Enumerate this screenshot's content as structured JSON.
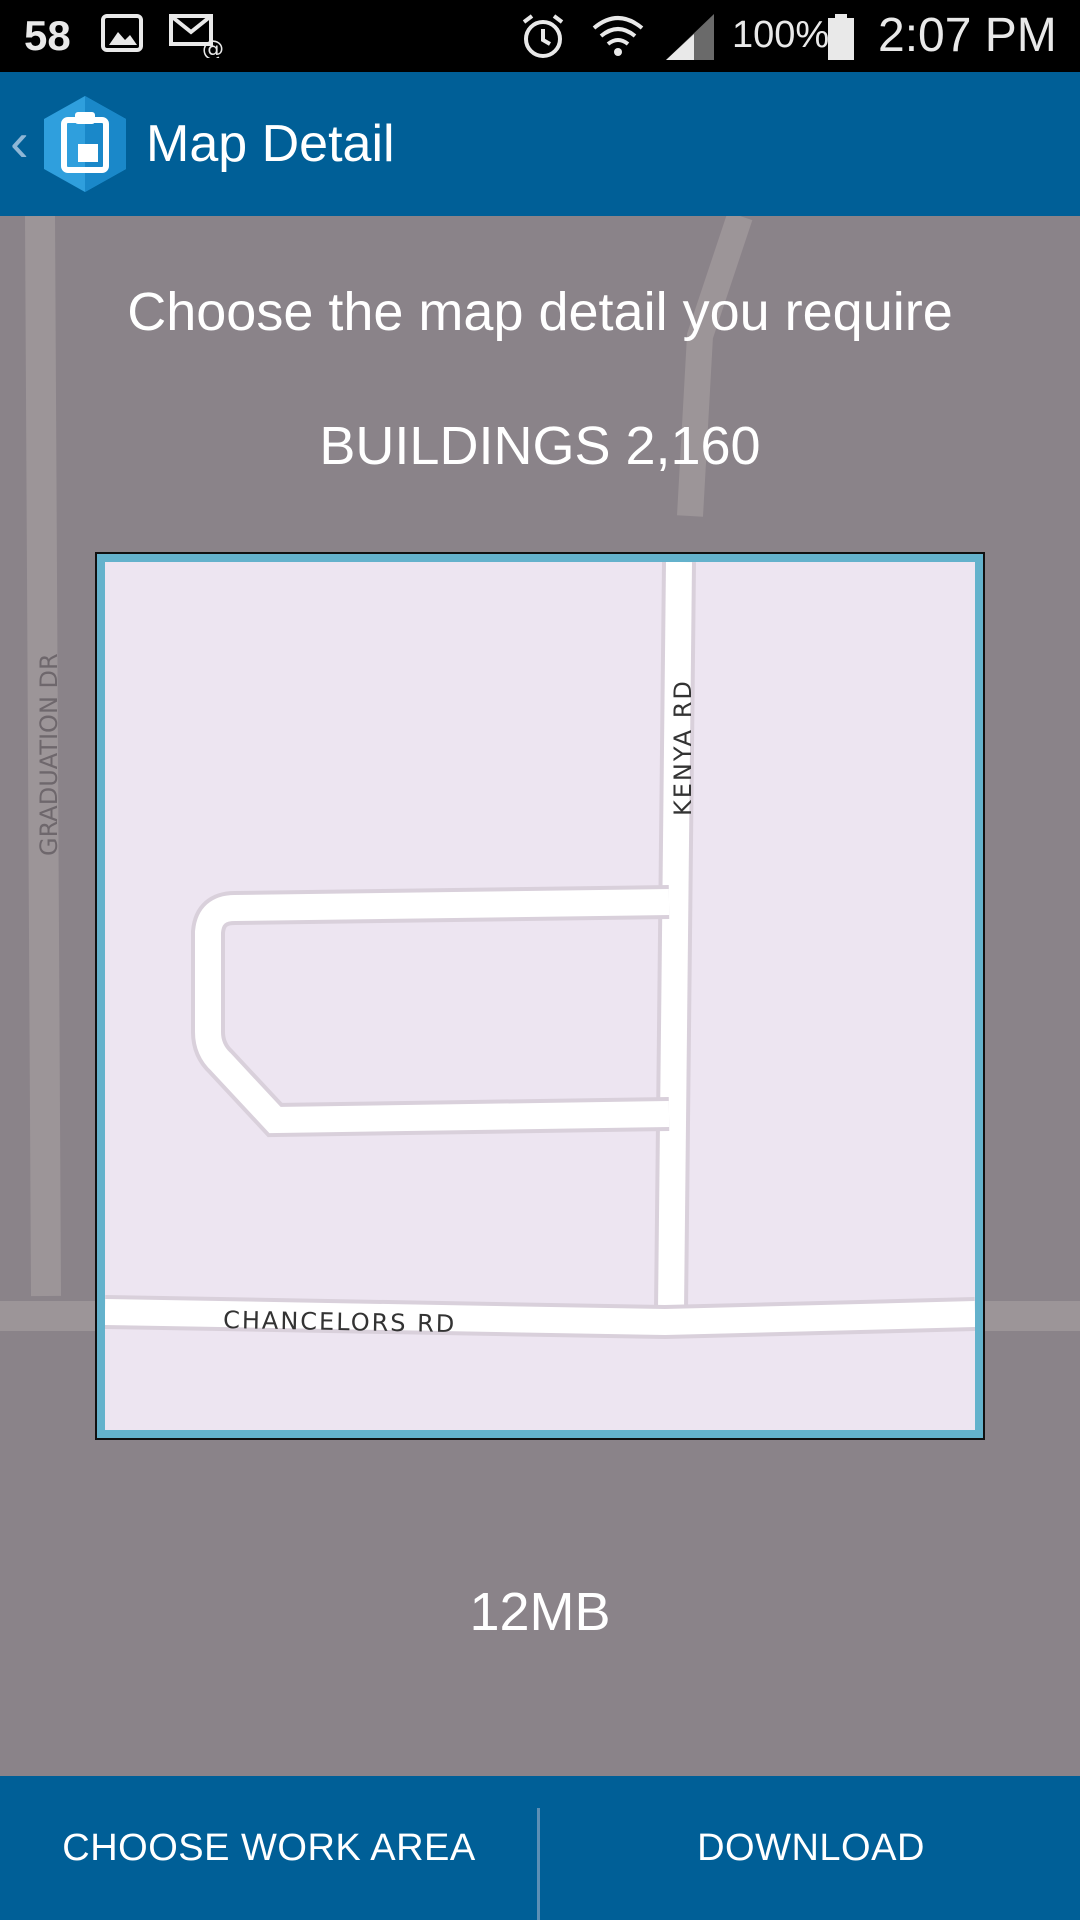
{
  "status_bar": {
    "left_number": "58",
    "battery_percent": "100%",
    "time": "2:07 PM",
    "icons": [
      "image-icon",
      "mail-at-icon",
      "alarm-icon",
      "wifi-icon",
      "signal-icon",
      "battery-icon"
    ]
  },
  "app_bar": {
    "title": "Map Detail",
    "back_icon": "chevron-left-icon",
    "logo_icon": "clipboard-app-icon"
  },
  "content": {
    "prompt": "Choose the map detail you require",
    "buildings": "BUILDINGS 2,160",
    "size": "12MB"
  },
  "map": {
    "street_labels": {
      "graduation": "GRADUATION DR",
      "kenya": "KENYA RD",
      "chancelors": "CHANCELORS RD"
    }
  },
  "actions": {
    "left_label": "CHOOSE WORK AREA",
    "right_label": "DOWNLOAD"
  },
  "colors": {
    "app_bar": "#005f97",
    "map_frame": "#64b2cc",
    "map_background": "#ede5f1",
    "overlay": "#8a8389"
  }
}
